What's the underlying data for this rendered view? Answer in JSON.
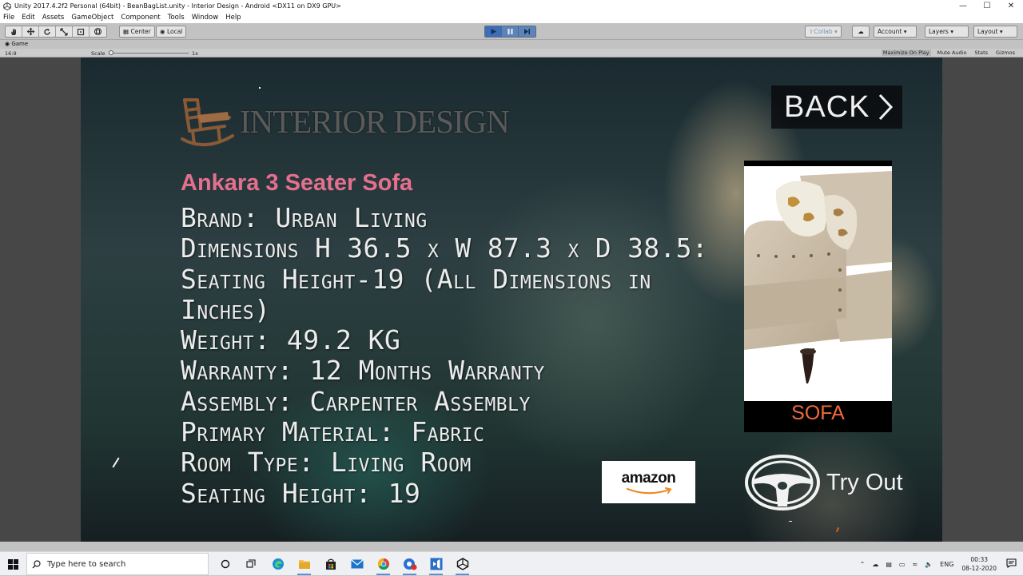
{
  "window": {
    "title": "Unity 2017.4.2f2 Personal (64bit) - BeanBagList.unity - Interior Design - Android <DX11 on DX9 GPU>",
    "controls": [
      "—",
      "☐",
      "✕"
    ]
  },
  "menu": [
    "File",
    "Edit",
    "Assets",
    "GameObject",
    "Component",
    "Tools",
    "Window",
    "Help"
  ],
  "toolbar": {
    "pivot": "Center",
    "space": "Local",
    "collab": "Collab",
    "account": "Account",
    "layers": "Layers",
    "layout": "Layout"
  },
  "game_tab": {
    "label": "Game",
    "aspect": "16:9",
    "scale_label": "Scale",
    "scale_value": "1x",
    "options": [
      "Maximize On Play",
      "Mute Audio",
      "Stats",
      "Gizmos"
    ]
  },
  "app": {
    "logo_text": "INTERIOR DESIGN",
    "back_label": "BACK",
    "product_title": "Ankara 3 Seater Sofa",
    "specs": [
      "Brand: Urban Living",
      "Dimensions H 36.5 x W 87.3 x D 38.5:",
      "Seating Height-19 (All Dimensions in",
      "Inches)",
      "Weight: 49.2 KG",
      "Warranty: 12 Months Warranty",
      "Assembly: Carpenter Assembly",
      "Primary Material: Fabric",
      "Room Type: Living Room",
      "Seating Height: 19"
    ],
    "card_caption": "SOFA",
    "amazon_label": "amazon",
    "tryout_label": "Try Out"
  },
  "taskbar": {
    "search_placeholder": "Type here to search",
    "language": "ENG",
    "time": "00:33",
    "date": "08-12-2020"
  }
}
